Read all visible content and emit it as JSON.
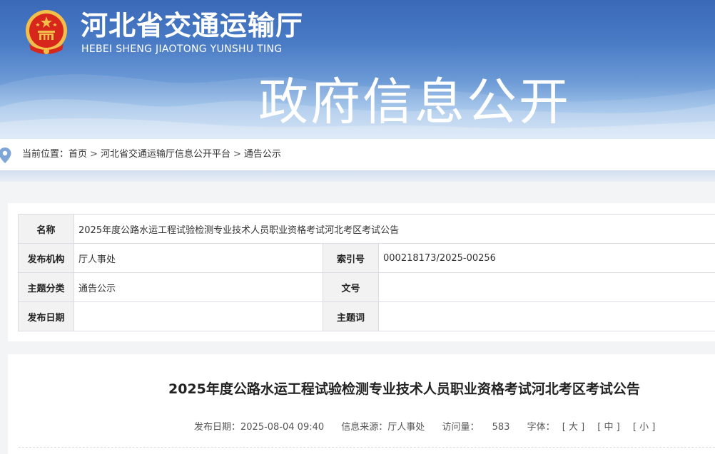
{
  "header": {
    "site_name": "河北省交通运输厅",
    "site_pinyin": "HEBEI SHENG JIAOTONG YUNSHU TING",
    "portal_title": "政府信息公开",
    "colors": {
      "banner_top": "#3a69b8",
      "banner_bottom": "#c7dcf3",
      "emblem_red": "#d7261b",
      "emblem_gold": "#f2c04a"
    }
  },
  "breadcrumb": {
    "prefix": "当前位置：",
    "items": [
      "首页",
      "河北省交通运输厅信息公开平台",
      "通告公示"
    ],
    "separator": ">"
  },
  "meta_table": {
    "name_label": "名称",
    "name_value": "2025年度公路水运工程试验检测专业技术人员职业资格考试河北考区考试公告",
    "publisher_label": "发布机构",
    "publisher_value": "厅人事处",
    "index_label": "索引号",
    "index_value": "000218173/2025-00256",
    "category_label": "主题分类",
    "category_value": "通告公示",
    "docno_label": "文号",
    "docno_value": "",
    "date_label": "发布日期",
    "date_value": "",
    "keyword_label": "主题词",
    "keyword_value": ""
  },
  "article": {
    "title": "2025年度公路水运工程试验检测专业技术人员职业资格考试河北考区考试公告",
    "publish_date": "发布日期：2025-08-04 09:40",
    "source": "信息来源：厅人事处",
    "visits_label": "访问量：",
    "visits_value": "583",
    "font_label": "字体：",
    "font_large": "[ 大 ]",
    "font_medium": "[ 中 ]",
    "font_small": "[ 小 ]"
  }
}
